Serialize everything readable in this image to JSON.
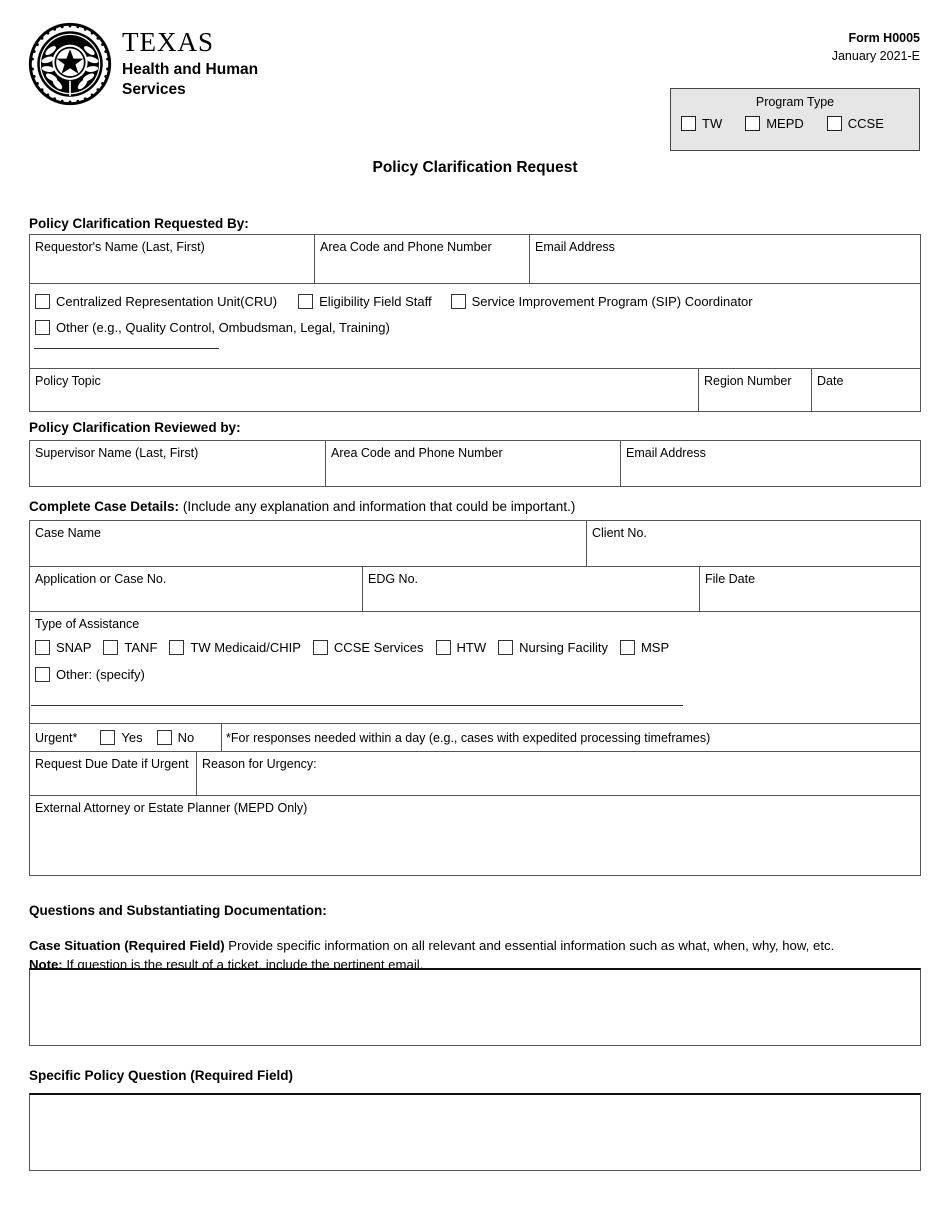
{
  "header": {
    "logo": {
      "seal_icon": "texas-state-seal-icon",
      "texas": "TEXAS",
      "line1": "Health and Human",
      "line2": "Services"
    },
    "form_number": "Form H0005",
    "form_date": "January 2021-E",
    "program_type": {
      "title": "Program Type",
      "options": [
        {
          "label": "TW",
          "checked": false
        },
        {
          "label": "MEPD",
          "checked": false
        },
        {
          "label": "CCSE",
          "checked": false
        }
      ]
    }
  },
  "title": "Policy Clarification Request",
  "requested_by": {
    "heading": "Policy Clarification Requested By:",
    "fields": [
      {
        "label": "Requestor's Name (Last, First)",
        "value": ""
      },
      {
        "label": "Area Code and Phone Number",
        "value": ""
      },
      {
        "label": "Email Address",
        "value": ""
      }
    ],
    "role_options_row1": [
      {
        "label": "Centralized Representation Unit(CRU)",
        "checked": false
      },
      {
        "label": "Eligibility Field Staff",
        "checked": false
      },
      {
        "label": "Service Improvement Program (SIP) Coordinator",
        "checked": false
      }
    ],
    "role_options_row2": [
      {
        "label": "Other (e.g., Quality Control, Ombudsman, Legal, Training)",
        "checked": false
      }
    ],
    "other_specify_value": "",
    "topic_fields": [
      {
        "label": "Policy Topic",
        "value": ""
      },
      {
        "label": "Region Number",
        "value": ""
      },
      {
        "label": "Date",
        "value": ""
      }
    ]
  },
  "reviewed_by": {
    "heading": "Policy Clarification Reviewed by:",
    "fields": [
      {
        "label": "Supervisor Name (Last, First)",
        "value": ""
      },
      {
        "label": "Area Code and Phone Number",
        "value": ""
      },
      {
        "label": "Email Address",
        "value": ""
      }
    ]
  },
  "case_details": {
    "heading_bold": "Complete Case Details:",
    "heading_rest": "(Include any explanation and information that could be important.)",
    "row1": [
      {
        "label": "Case Name",
        "value": ""
      },
      {
        "label": "Client No.",
        "value": ""
      }
    ],
    "row2": [
      {
        "label": "Application or Case No.",
        "value": ""
      },
      {
        "label": "EDG No.",
        "value": ""
      },
      {
        "label": "File Date",
        "value": ""
      }
    ],
    "assistance": {
      "label": "Type of Assistance",
      "options": [
        {
          "label": "SNAP",
          "checked": false
        },
        {
          "label": "TANF",
          "checked": false
        },
        {
          "label": "TW Medicaid/CHIP",
          "checked": false
        },
        {
          "label": "CCSE Services",
          "checked": false
        },
        {
          "label": "HTW",
          "checked": false
        },
        {
          "label": "Nursing Facility",
          "checked": false
        },
        {
          "label": "MSP",
          "checked": false
        }
      ],
      "other": {
        "label": "Other: (specify)",
        "checked": false,
        "value": ""
      }
    },
    "urgent": {
      "label": "Urgent*",
      "yes_label": "Yes",
      "no_label": "No",
      "yes_checked": false,
      "no_checked": false,
      "note": "*For responses needed within a day (e.g., cases with expedited processing timeframes)"
    },
    "due_date": {
      "label": "Request Due Date if Urgent",
      "value": ""
    },
    "reason": {
      "label": "Reason for Urgency:",
      "value": ""
    },
    "external_attorney": {
      "label": "External Attorney or Estate Planner (MEPD Only)",
      "value": ""
    }
  },
  "questions": {
    "heading": "Questions and Substantiating Documentation:",
    "case_situation_bold": "Case Situation (Required Field)",
    "case_situation_rest": " Provide specific information on all relevant and essential information such as what, when, why, how, etc.",
    "note_bold": "Note:",
    "note_rest": " If question is the result of a ticket, include the pertinent email.",
    "case_situation_value": "",
    "policy_question_heading": "Specific Policy Question (Required Field)",
    "policy_question_value": ""
  }
}
